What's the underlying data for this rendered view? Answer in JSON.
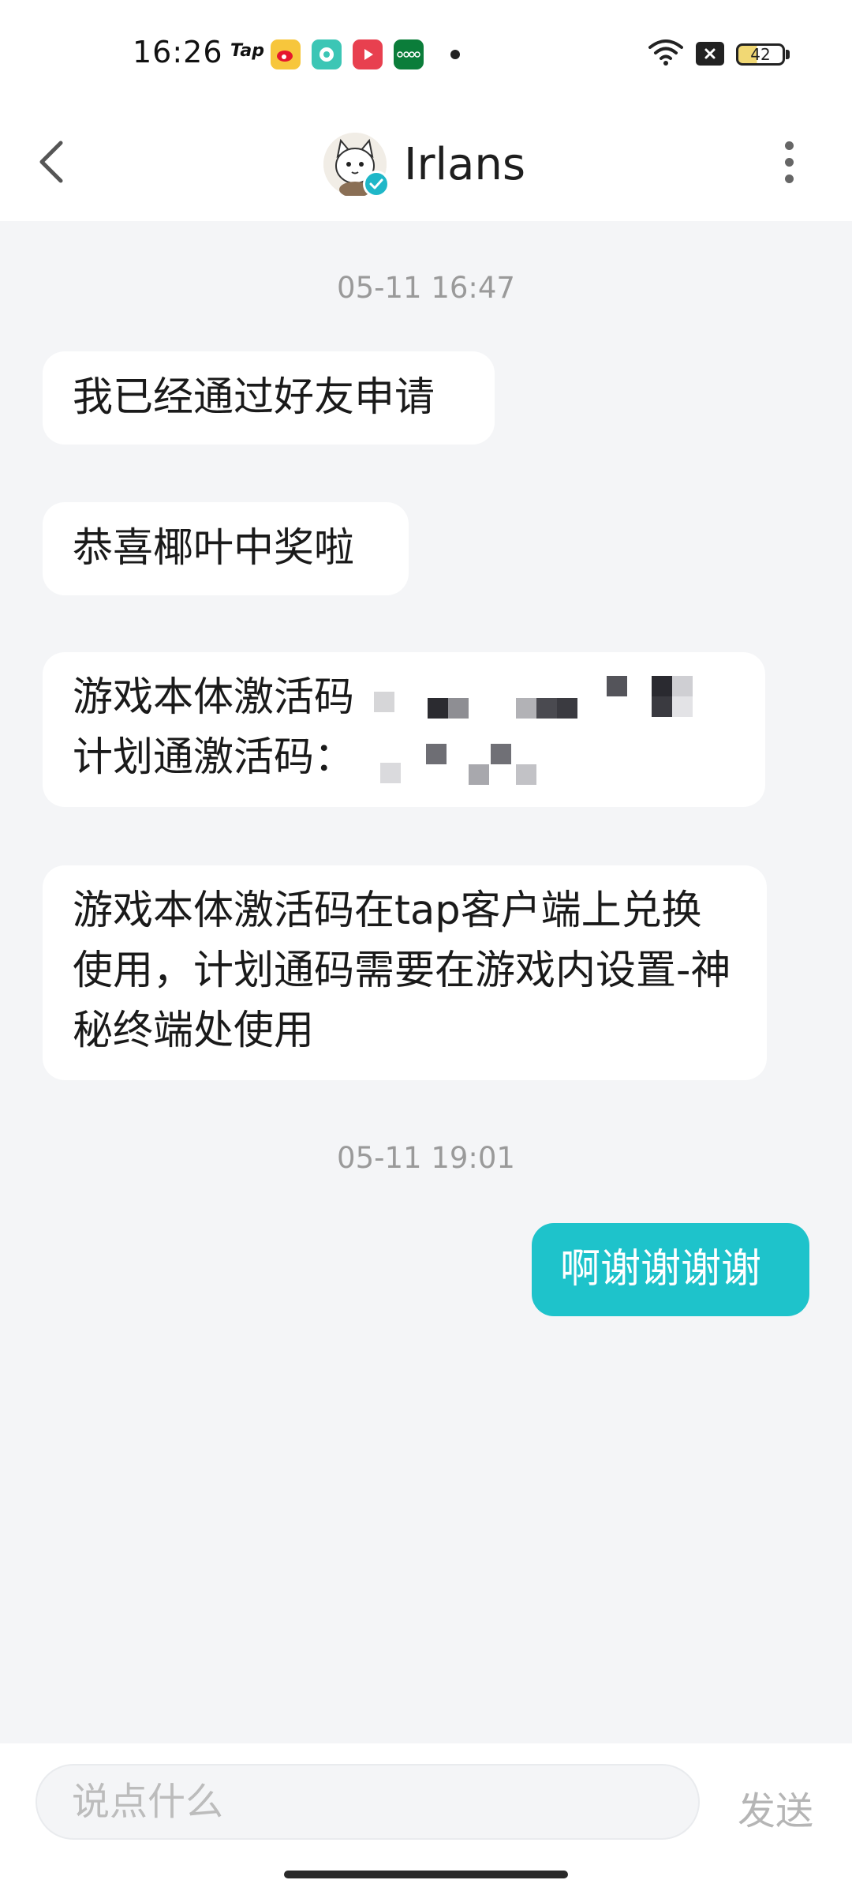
{
  "status_bar": {
    "time": "16:26",
    "tap_label": "Tap",
    "battery_level": "42",
    "notification_icons": [
      "tap-icon",
      "weibo-icon",
      "chat-app-icon",
      "video-app-icon",
      "oppo-icon"
    ],
    "system_icons": [
      "wifi-icon",
      "no-sim-icon",
      "battery-icon"
    ]
  },
  "header": {
    "contact_name": "Irlans",
    "back_icon": "chevron-left-icon",
    "more_icon": "more-vertical-icon",
    "verified": true
  },
  "chat": {
    "timestamp_1": "05-11 16:47",
    "message_1": "我已经通过好友申请",
    "message_2": "恭喜椰叶中奖啦",
    "message_3_line_1": "游戏本体激活码",
    "message_3_line_2": "计划通激活码：",
    "message_4": "游戏本体激活码在tap客户端上兑换使用，计划通码需要在游戏内设置-神秘终端处使用",
    "timestamp_2": "05-11 19:01",
    "message_5": "啊谢谢谢谢"
  },
  "input_bar": {
    "placeholder": "说点什么",
    "send_label": "发送"
  },
  "colors": {
    "accent": "#1ec3cb",
    "background": "#f4f5f7",
    "bubble_incoming": "#ffffff"
  }
}
